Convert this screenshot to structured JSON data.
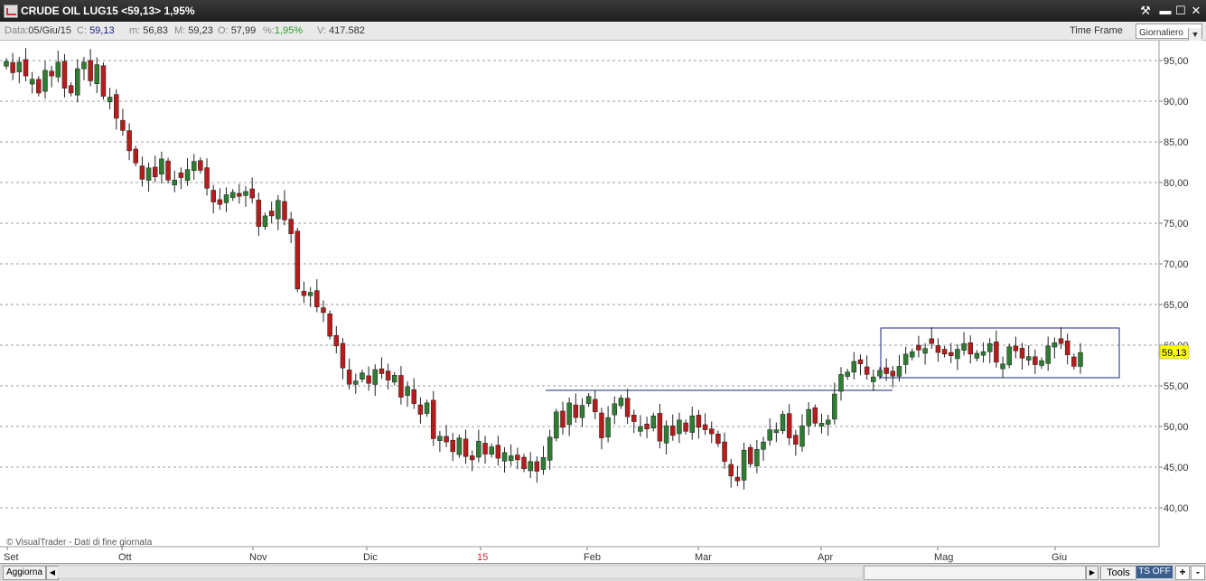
{
  "window": {
    "title": "CRUDE OIL LUG15 <59,13> 1,95%",
    "buttons": [
      "tools",
      "minimize",
      "maximize",
      "close"
    ]
  },
  "info": {
    "data_label": "Data:",
    "data_value": "05/Giu/15",
    "close_label": "C:",
    "close_value": "59,13",
    "min_label": "m:",
    "min_value": "56,83",
    "max_label": "M:",
    "max_value": "59,23",
    "open_label": "O:",
    "open_value": "57,99",
    "pct_label": "%:",
    "pct_value": "1,95%",
    "vol_label": "V:",
    "vol_value": "417.582",
    "timeframe_label": "Time Frame",
    "timeframe_value": "Giornaliero"
  },
  "colors": {
    "up": "#2e7d32",
    "down": "#b71c1c",
    "grid": "#9e9e9e",
    "box": "#1a237e",
    "price_tag": "#ffff00"
  },
  "watermark": "© VisualTrader - Dati di fine giornata",
  "price_tag": "59,13",
  "bottom": {
    "refresh": "Aggiorna",
    "tools": "Tools",
    "ts": "TS OFF",
    "plus": "+",
    "minus": "-"
  },
  "chart_data": {
    "type": "candlestick",
    "ylim": [
      40,
      96
    ],
    "y_ticks": [
      "95,00",
      "90,00",
      "85,00",
      "80,00",
      "75,00",
      "70,00",
      "65,00",
      "60,00",
      "55,00",
      "50,00",
      "45,00",
      "40,00"
    ],
    "x_labels": [
      "Set",
      "Ott",
      "Nov",
      "Dic",
      "15",
      "Feb",
      "Mar",
      "Apr",
      "Mag",
      "Giu"
    ],
    "close_series": [
      94.9,
      93.5,
      94.8,
      93.1,
      92.7,
      91.0,
      93.8,
      93.1,
      94.8,
      91.6,
      91.0,
      94.0,
      94.8,
      92.5,
      94.5,
      90.6,
      90.5,
      87.9,
      86.4,
      83.9,
      82.4,
      80.4,
      81.8,
      80.7,
      82.9,
      80.3,
      80.3,
      80.6,
      81.6,
      82.6,
      81.5,
      79.3,
      77.6,
      77.3,
      78.5,
      78.8,
      78.3,
      78.9,
      78.1,
      74.6,
      75.9,
      75.9,
      77.8,
      75.4,
      73.7,
      66.9,
      66.1,
      66.5,
      64.7,
      64.0,
      61.1,
      59.9,
      57.2,
      55.2,
      55.6,
      56.6,
      55.3,
      57.0,
      56.5,
      55.7,
      56.3,
      53.6,
      54.9,
      52.8,
      51.5,
      52.9,
      48.5,
      48.8,
      48.1,
      46.9,
      48.6,
      46.3,
      45.9,
      48.2,
      46.6,
      47.5,
      46.1,
      46.8,
      46.4,
      45.9,
      44.8,
      45.7,
      44.5,
      46.2,
      48.7,
      51.8,
      49.9,
      52.9,
      51.1,
      52.6,
      53.7,
      51.8,
      48.6,
      51.1,
      52.8,
      53.5,
      51.2,
      50.6,
      50.0,
      49.7,
      51.3,
      48.2,
      50.1,
      48.9,
      50.8,
      49.4,
      51.3,
      49.9,
      49.6,
      49.1,
      47.9,
      45.7,
      43.9,
      43.3,
      47.1,
      45.4,
      47.2,
      48.1,
      49.6,
      49.6,
      51.5,
      48.6,
      47.8,
      50.1,
      52.1,
      50.4,
      50.4,
      50.8,
      54.0,
      56.4,
      56.7,
      58.0,
      57.7,
      56.4,
      56.1,
      56.9,
      56.5,
      56.2,
      57.4,
      58.9,
      59.2,
      59.4,
      59.6,
      60.2,
      59.1,
      58.9,
      58.7,
      59.5,
      60.2,
      58.9,
      59.0,
      59.2,
      60.2,
      57.9,
      57.7,
      59.8,
      59.3,
      58.4,
      58.6,
      57.6,
      58.1,
      59.9,
      60.3,
      60.2,
      58.8,
      57.4,
      59.1
    ]
  }
}
